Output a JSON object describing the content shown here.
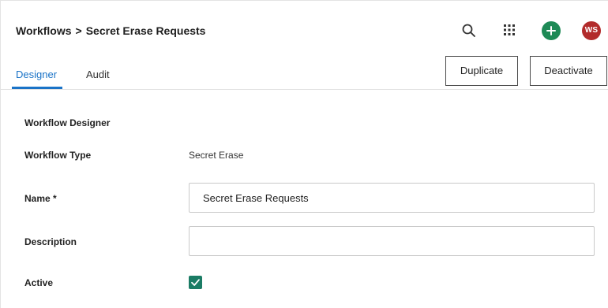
{
  "header": {
    "breadcrumb_root": "Workflows",
    "breadcrumb_separator": ">",
    "breadcrumb_current": "Secret Erase Requests",
    "icons": {
      "search": "search-icon",
      "apps": "apps-grid-icon",
      "add": "plus-icon"
    },
    "avatar_initials": "WS",
    "colors": {
      "add_button": "#1e8a56",
      "avatar": "#b22b2b",
      "active_tab": "#1a73c7"
    }
  },
  "tabs": [
    {
      "label": "Designer",
      "active": true
    },
    {
      "label": "Audit",
      "active": false
    }
  ],
  "actions": {
    "duplicate_label": "Duplicate",
    "deactivate_label": "Deactivate"
  },
  "form": {
    "section_title": "Workflow Designer",
    "type_label": "Workflow Type",
    "type_value": "Secret Erase",
    "name_label": "Name *",
    "name_value": "Secret Erase Requests",
    "description_label": "Description",
    "description_value": "",
    "active_label": "Active",
    "active_checked": true,
    "checkbox_color": "#1b7c65"
  }
}
